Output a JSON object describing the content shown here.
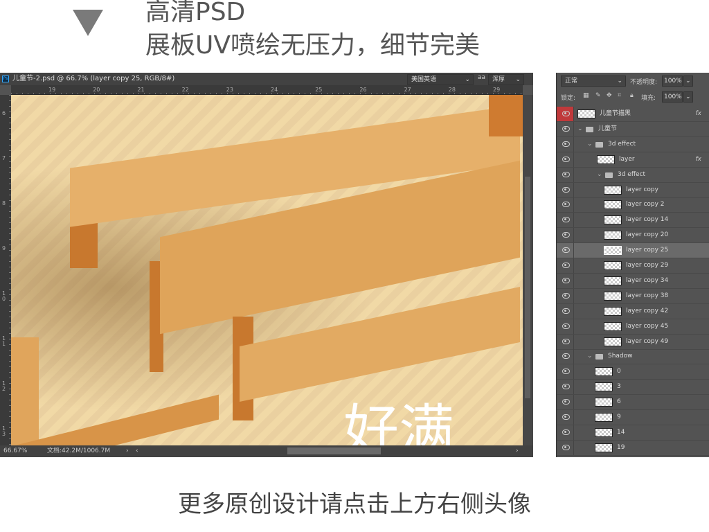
{
  "headline": {
    "line1": "高清PSD",
    "line2": "展板UV喷绘无压力，细节完美"
  },
  "document": {
    "title": "儿童节-2.psd @ 66.7% (layer copy 25, RGB/8#)",
    "ps_icon": "Ps",
    "ruler_h": [
      "19",
      "20",
      "21",
      "22",
      "23",
      "24",
      "25",
      "26",
      "27",
      "28",
      "29"
    ],
    "ruler_v": [
      "6",
      "7",
      "8",
      "9",
      "1\n0",
      "1\n1",
      "1\n2",
      "1\n3"
    ],
    "zoom": "66.67%",
    "doc_size": "文档:42.2M/1006.7M",
    "canvas_text": "好满"
  },
  "options": {
    "language": "美国英语",
    "aa_icon": "aa",
    "aa_mode": "浑厚"
  },
  "layers_panel": {
    "blend_mode": "正常",
    "opacity_label": "不透明度:",
    "opacity": "100%",
    "lock_label": "锁定:",
    "fill_label": "填充:",
    "fill": "100%",
    "layers": [
      {
        "name": "儿童节描黑",
        "type": "layer",
        "fx": "fx",
        "indent": 0,
        "active_eye": true
      },
      {
        "name": "儿童节",
        "type": "group",
        "indent": 0
      },
      {
        "name": "3d effect",
        "type": "group",
        "indent": 1
      },
      {
        "name": "layer",
        "type": "layer",
        "fx": "fx",
        "indent": 2
      },
      {
        "name": "3d effect",
        "type": "group",
        "indent": 2
      },
      {
        "name": "layer copy",
        "type": "layer",
        "indent": 3
      },
      {
        "name": "layer copy 2",
        "type": "layer",
        "indent": 3
      },
      {
        "name": "layer copy 14",
        "type": "layer",
        "indent": 3
      },
      {
        "name": "layer copy 20",
        "type": "layer",
        "indent": 3
      },
      {
        "name": "layer copy 25",
        "type": "layer",
        "indent": 3,
        "selected": true
      },
      {
        "name": "layer copy 29",
        "type": "layer",
        "indent": 3
      },
      {
        "name": "layer copy 34",
        "type": "layer",
        "indent": 3
      },
      {
        "name": "layer copy 38",
        "type": "layer",
        "indent": 3
      },
      {
        "name": "layer copy 42",
        "type": "layer",
        "indent": 3
      },
      {
        "name": "layer copy 45",
        "type": "layer",
        "indent": 3
      },
      {
        "name": "layer copy 49",
        "type": "layer",
        "indent": 3
      },
      {
        "name": "Shadow",
        "type": "group",
        "indent": 1
      },
      {
        "name": "0",
        "type": "layer",
        "indent": 2
      },
      {
        "name": "3",
        "type": "layer",
        "indent": 2
      },
      {
        "name": "6",
        "type": "layer",
        "indent": 2
      },
      {
        "name": "9",
        "type": "layer",
        "indent": 2
      },
      {
        "name": "14",
        "type": "layer",
        "indent": 2
      },
      {
        "name": "19",
        "type": "layer",
        "indent": 2
      }
    ]
  },
  "footer": "更多原创设计请点击上方右侧头像"
}
